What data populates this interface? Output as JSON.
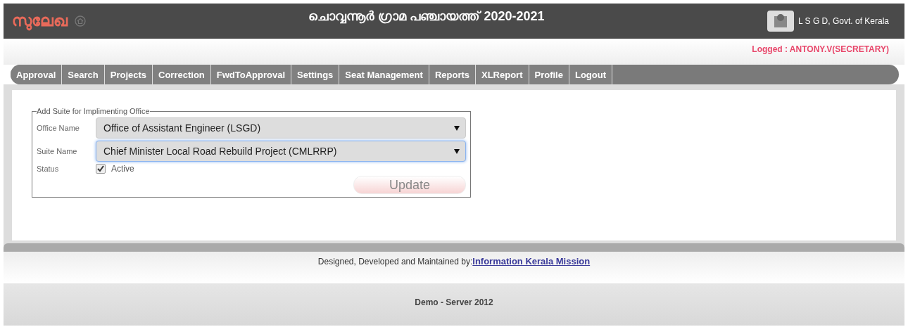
{
  "header": {
    "brand": "സുലേഖ",
    "title": "ചൊവ്വന്നൂർ ഗ്രാമ പഞ്ചായത്ത് 2020-2021",
    "org": "L S G D, Govt. of Kerala"
  },
  "logged": "Logged : ANTONY.V(SECRETARY)",
  "nav": [
    "Approval",
    "Search",
    "Projects",
    "Correction",
    "FwdToApproval",
    "Settings",
    "Seat Management",
    "Reports",
    "XLReport",
    "Profile",
    "Logout"
  ],
  "form": {
    "legend": "Add Suite for Implimenting Office",
    "fields": [
      {
        "label": "Office Name",
        "value": "Office of Assistant Engineer (LSGD)",
        "focused": false
      },
      {
        "label": "Suite Name",
        "value": "Chief Minister Local Road Rebuild Project (CMLRRP)",
        "focused": true
      }
    ],
    "status": {
      "label": "Status",
      "option": "Active",
      "checked": true
    },
    "button": "Update"
  },
  "footer": {
    "credit": "Designed, Developed and Maintained by:",
    "link": "Information Kerala Mission",
    "server": "Demo - Server 2012"
  }
}
